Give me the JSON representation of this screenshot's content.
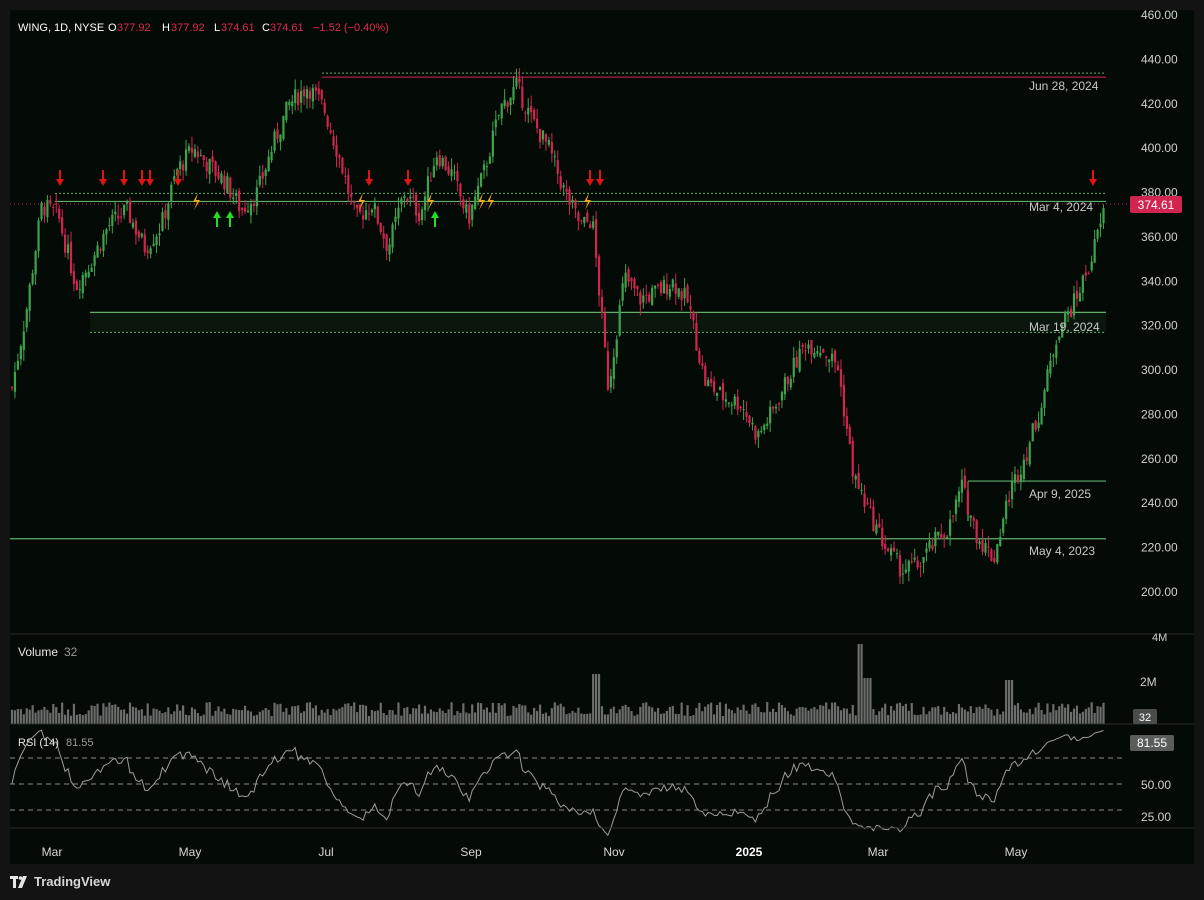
{
  "header": {
    "symbol": "WING, 1D, NYSE",
    "open_label": "O",
    "open_value": "377.92",
    "high_label": "H",
    "high_value": "377.92",
    "low_label": "L",
    "low_value": "374.61",
    "close_label": "C",
    "close_value": "374.61",
    "change": "−1.52 (−0.40%)"
  },
  "colors": {
    "up": "#3fa34d",
    "down": "#d0254f",
    "level_line": "#5fae6a",
    "resistance_line": "#d0254f",
    "rsi_line": "#9c9c9c",
    "sell_arrow": "#e01414",
    "buy_arrow": "#22dd22",
    "bolt": "#f2a51c",
    "last_price_bg": "#d0254f",
    "background": "#040a05"
  },
  "price_axis": {
    "ticks": [
      "460.00",
      "440.00",
      "420.00",
      "400.00",
      "380.00",
      "360.00",
      "340.00",
      "320.00",
      "300.00",
      "280.00",
      "260.00",
      "240.00",
      "220.00",
      "200.00"
    ],
    "last_price": "374.61"
  },
  "levels": [
    {
      "label": "Jun 28, 2024"
    },
    {
      "label": "Mar 4, 2024"
    },
    {
      "label": "Mar 19, 2024"
    },
    {
      "label": "Apr 9, 2025"
    },
    {
      "label": "May 4, 2023"
    }
  ],
  "volume": {
    "title": "Volume",
    "value": "32",
    "ticks": [
      "4M",
      "2M"
    ],
    "badge": "32"
  },
  "rsi": {
    "title": "RSI (14)",
    "value": "81.55",
    "ticks": [
      "50.00",
      "25.00"
    ],
    "badge": "81.55"
  },
  "time_axis": {
    "labels": [
      "Mar",
      "May",
      "Jul",
      "Sep",
      "Nov",
      "2025",
      "Mar",
      "May"
    ]
  },
  "branding": {
    "name": "TradingView"
  },
  "chart_data": {
    "type": "candlestick",
    "symbol": "WING",
    "interval": "1D",
    "exchange": "NYSE",
    "ylim": [
      195,
      460
    ],
    "series": [
      {
        "name": "close_approx",
        "points": [
          [
            "2024-02-20",
            292
          ],
          [
            "2024-02-26",
            325
          ],
          [
            "2024-03-04",
            374
          ],
          [
            "2024-03-11",
            370
          ],
          [
            "2024-03-19",
            338
          ],
          [
            "2024-03-26",
            350
          ],
          [
            "2024-04-02",
            365
          ],
          [
            "2024-04-10",
            372
          ],
          [
            "2024-04-18",
            355
          ],
          [
            "2024-04-25",
            365
          ],
          [
            "2024-05-02",
            390
          ],
          [
            "2024-05-09",
            400
          ],
          [
            "2024-05-16",
            392
          ],
          [
            "2024-05-23",
            385
          ],
          [
            "2024-05-30",
            372
          ],
          [
            "2024-06-06",
            380
          ],
          [
            "2024-06-13",
            402
          ],
          [
            "2024-06-20",
            420
          ],
          [
            "2024-06-28",
            428
          ],
          [
            "2024-07-05",
            418
          ],
          [
            "2024-07-12",
            395
          ],
          [
            "2024-07-19",
            368
          ],
          [
            "2024-07-26",
            375
          ],
          [
            "2024-08-02",
            355
          ],
          [
            "2024-08-09",
            380
          ],
          [
            "2024-08-16",
            370
          ],
          [
            "2024-08-23",
            398
          ],
          [
            "2024-08-30",
            388
          ],
          [
            "2024-09-06",
            368
          ],
          [
            "2024-09-13",
            390
          ],
          [
            "2024-09-20",
            418
          ],
          [
            "2024-09-27",
            428
          ],
          [
            "2024-10-04",
            412
          ],
          [
            "2024-10-11",
            400
          ],
          [
            "2024-10-18",
            380
          ],
          [
            "2024-10-25",
            365
          ],
          [
            "2024-10-30",
            368
          ],
          [
            "2024-11-06",
            292
          ],
          [
            "2024-11-13",
            342
          ],
          [
            "2024-11-20",
            332
          ],
          [
            "2024-11-27",
            335
          ],
          [
            "2024-12-04",
            340
          ],
          [
            "2024-12-11",
            330
          ],
          [
            "2024-12-18",
            295
          ],
          [
            "2024-12-26",
            288
          ],
          [
            "2025-01-03",
            285
          ],
          [
            "2025-01-10",
            270
          ],
          [
            "2025-01-17",
            282
          ],
          [
            "2025-01-24",
            298
          ],
          [
            "2025-01-31",
            312
          ],
          [
            "2025-02-07",
            310
          ],
          [
            "2025-02-14",
            302
          ],
          [
            "2025-02-21",
            252
          ],
          [
            "2025-02-28",
            235
          ],
          [
            "2025-03-07",
            220
          ],
          [
            "2025-03-14",
            210
          ],
          [
            "2025-03-21",
            212
          ],
          [
            "2025-03-28",
            222
          ],
          [
            "2025-04-04",
            230
          ],
          [
            "2025-04-09",
            248
          ],
          [
            "2025-04-16",
            225
          ],
          [
            "2025-04-23",
            215
          ],
          [
            "2025-04-30",
            245
          ],
          [
            "2025-05-07",
            262
          ],
          [
            "2025-05-14",
            285
          ],
          [
            "2025-05-21",
            318
          ],
          [
            "2025-05-28",
            330
          ],
          [
            "2025-06-04",
            348
          ],
          [
            "2025-06-11",
            374.61
          ]
        ]
      }
    ],
    "levels": [
      432,
      376,
      326,
      250,
      224
    ],
    "rsi_levels": [
      70,
      50,
      30
    ],
    "last": {
      "open": 377.92,
      "high": 377.92,
      "low": 374.61,
      "close": 374.61,
      "change": -1.52,
      "change_pct": -0.4
    }
  }
}
